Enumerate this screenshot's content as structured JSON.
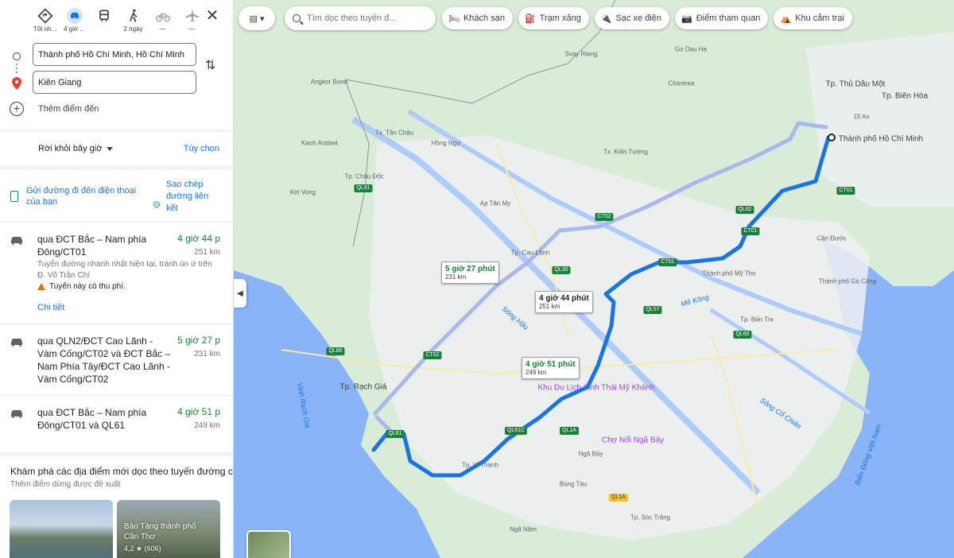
{
  "modes": [
    {
      "name": "best",
      "label": "Tốt nh..."
    },
    {
      "name": "drive",
      "label": "4 giờ ..."
    },
    {
      "name": "transit",
      "label": ""
    },
    {
      "name": "walk",
      "label": "2 ngày"
    },
    {
      "name": "bike",
      "label": "—"
    },
    {
      "name": "flight",
      "label": "—"
    }
  ],
  "origin": "Thành phố Hồ Chí Minh, Hồ Chí Minh",
  "destination": "Kiên Giang",
  "add_destination": "Thêm điểm đến",
  "depart_label": "Rời khỏi bây giờ",
  "options_label": "Tùy chọn",
  "send_to_phone": "Gửi đường đi đến điện thoại của bạn",
  "copy_link": "Sao chép đường liên kết",
  "routes": [
    {
      "via": "qua ĐCT Bắc – Nam phía Đông/CT01",
      "duration": "4 giờ 44 p",
      "distance": "251 km",
      "description": "Tuyến đường nhanh nhất hiện tại, tránh ùn ứ trên Đ. Võ Trần Chí",
      "toll": "Tuyến này có thu phí.",
      "details": "Chi tiết"
    },
    {
      "via": "qua QLN2/ĐCT Cao Lãnh - Vàm Cống/CT02 và ĐCT Bắc – Nam Phía Tây/ĐCT Cao Lãnh - Vàm Cống/CT02",
      "duration": "5 giờ 27 p",
      "distance": "231 km"
    },
    {
      "via": "qua ĐCT Bắc – Nam phía Đông/CT01 và QL61",
      "duration": "4 giờ 51 p",
      "distance": "249 km"
    }
  ],
  "explore": {
    "heading": "Khám phá các địa điểm mới dọc theo tuyến đường c",
    "subheading": "Thêm điểm dừng được đề xuất",
    "cards": [
      {
        "title": "",
        "rating": ""
      },
      {
        "title": "Bảo Tàng thành phố Cần Thơ",
        "rating": "4,2 ★ (606)"
      }
    ]
  },
  "search": {
    "placeholder": "Tìm dọc theo tuyến đ..."
  },
  "chips": [
    {
      "icon": "bed-icon",
      "label": "Khách sạn"
    },
    {
      "icon": "gas-icon",
      "label": "Trạm xăng"
    },
    {
      "icon": "ev-icon",
      "label": "Sạc xe điện"
    },
    {
      "icon": "camera-icon",
      "label": "Điểm tham quan"
    },
    {
      "icon": "tent-icon",
      "label": "Khu cắm trại"
    }
  ],
  "route_boxes": [
    {
      "time": "5 giờ 27 phút",
      "dist": "231 km"
    },
    {
      "time": "4 giờ 44 phút",
      "dist": "251 km"
    },
    {
      "time": "4 giờ 51 phút",
      "dist": "249 km"
    }
  ],
  "map_labels": {
    "hcm": "Thành phố Hồ Chí Minh",
    "thu_dau_mot": "Tp. Thủ Dầu Một",
    "bien_hoa": "Tp. Biên Hòa",
    "di_an": "Dĩ An",
    "rach_gia": "Tp. Rạch Giá",
    "cao_lanh": "Tp. Cao Lãnh",
    "chau_doc": "Tp. Châu Đốc",
    "tan_chau": "Tx. Tân Châu",
    "hong_ngu": "Hồng Ngự",
    "my_tho": "Thành phố Mỹ Tho",
    "ben_tre": "Tp. Bến Tre",
    "can_duoc": "Cần Đước",
    "go_cong": "Thành phố Gò Công",
    "kien_tuong": "Tx. Kiến Tường",
    "soc_trang": "Tp. Sóc Trăng",
    "nga_bay": "Ngã Bảy",
    "nga_nam": "Ngã Năm",
    "vi_thanh": "Tp. Vị Thanh",
    "ap_tan_my": "Ap Tân My",
    "kaoh_andaet": "Kaoh Andaet",
    "kiri_vong": "Kiri Vong",
    "angkor_borei": "Angkor Borei",
    "svay_rieng": "Svay Rieng",
    "chantrea": "Chantrea",
    "go_dau_ha": "Go Dau Ha",
    "bung_tau": "Bùng Tàu",
    "poi_my_khanh": "Khu Du Lịch Sinh Thái Mỹ Khánh",
    "poi_nga_bay": "Chợ Nổi Ngã Bảy",
    "song_hau": "Sông Hậu",
    "me_kong": "Mê Kông",
    "vinh_rach_gia": "Vịnh Rạch Giá",
    "bien_dong": "Biển Đông Việt Nam",
    "song_co_chien": "Sông Cổ Chiên"
  }
}
